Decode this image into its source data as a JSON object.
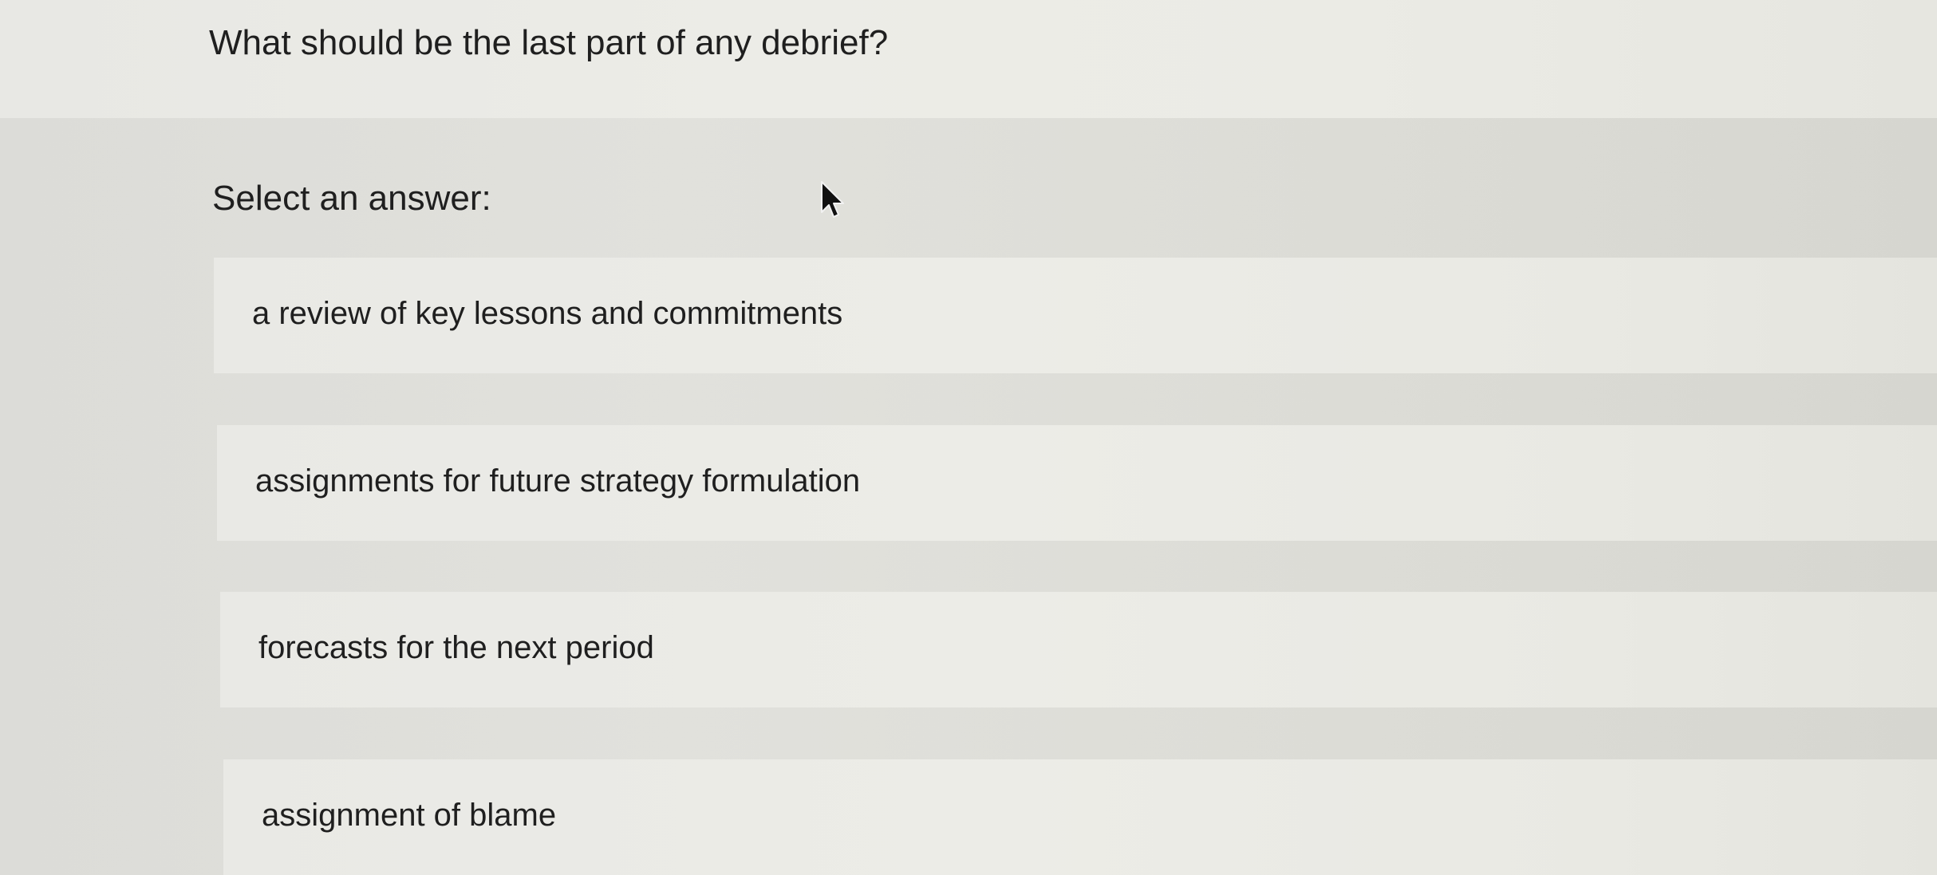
{
  "question": {
    "text": "What should be the last part of any debrief?"
  },
  "prompt": {
    "text": "Select an answer:"
  },
  "answers": [
    {
      "label": "a review of key lessons and commitments"
    },
    {
      "label": "assignments for future strategy formulation"
    },
    {
      "label": "forecasts for the next period"
    },
    {
      "label": "assignment of blame"
    }
  ],
  "cursor": {
    "icon": "arrow-pointer-icon"
  }
}
